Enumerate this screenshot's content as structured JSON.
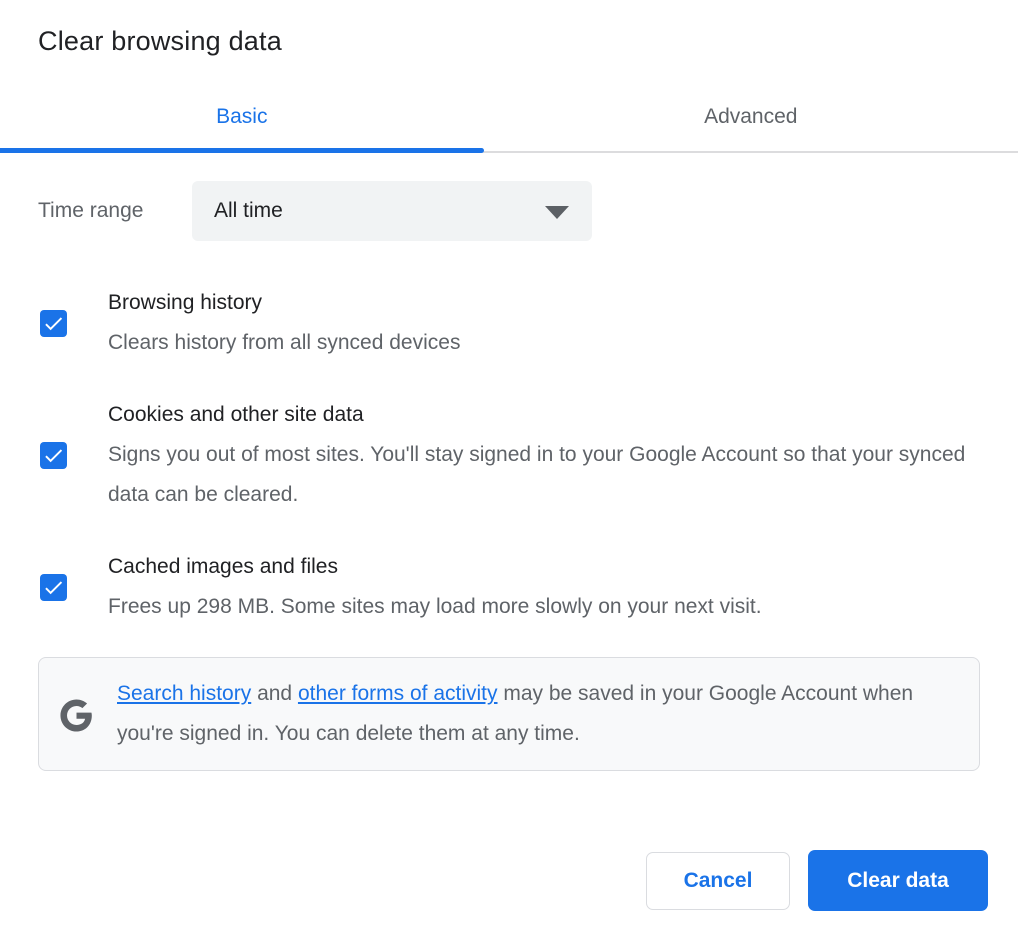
{
  "dialog": {
    "title": "Clear browsing data",
    "tabs": {
      "basic_label": "Basic",
      "advanced_label": "Advanced",
      "active_tab": "Basic"
    },
    "time_range": {
      "label": "Time range",
      "value": "All time"
    },
    "options": [
      {
        "title": "Browsing history",
        "description": "Clears history from all synced devices",
        "checked": true
      },
      {
        "title": "Cookies and other site data",
        "description": "Signs you out of most sites. You'll stay signed in to your Google Account so that your synced data can be cleared.",
        "checked": true
      },
      {
        "title": "Cached images and files",
        "description": "Frees up 298 MB. Some sites may load more slowly on your next visit.",
        "checked": true
      }
    ],
    "notice": {
      "icon": "google-g-icon",
      "link1": "Search history",
      "conjunction": " and ",
      "link2": "other forms of activity",
      "rest": " may be saved in your Google Account when you're signed in. You can delete them at any time."
    },
    "buttons": {
      "cancel": "Cancel",
      "confirm": "Clear data"
    },
    "colors": {
      "accent": "#1a73e8",
      "text_primary": "#202124",
      "text_secondary": "#5f6368",
      "divider": "#dcdcde",
      "dropdown_bg": "#f1f3f4",
      "notice_bg": "#f8f9fa",
      "notice_border": "#dadce0"
    }
  }
}
